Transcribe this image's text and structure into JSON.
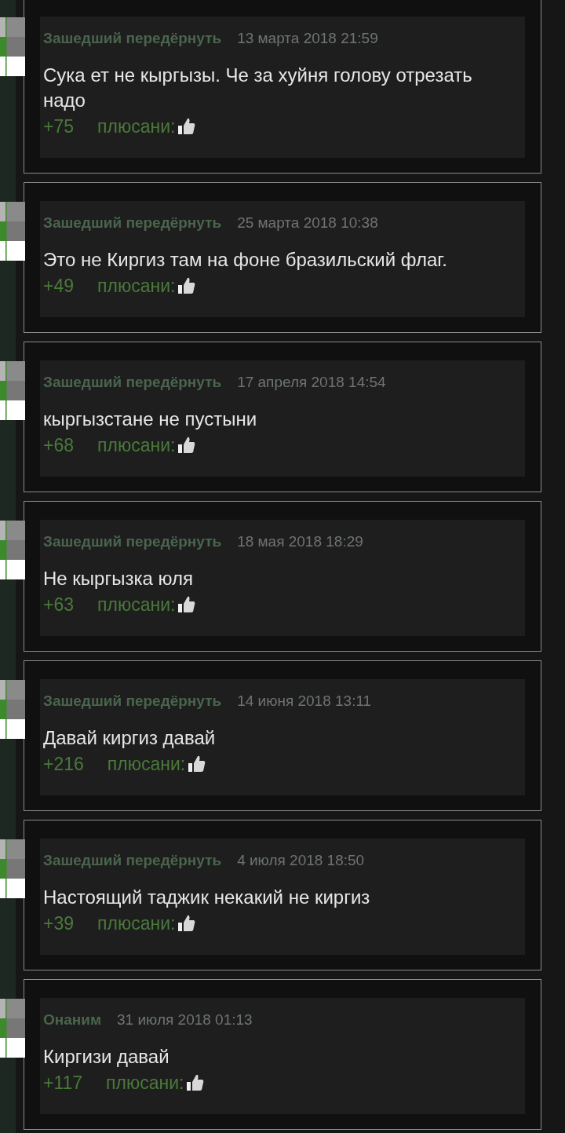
{
  "comments": [
    {
      "author": "Зашедший передёрнуть",
      "date": "13 марта 2018 21:59",
      "text": "Сука ет не кыргызы. Че за хуйня голову отрезать надо",
      "rating": "+75",
      "rate_label": "плюсани:"
    },
    {
      "author": "Зашедший передёрнуть",
      "date": "25 марта 2018 10:38",
      "text": "Это не Киргиз там на фоне бразильский флаг.",
      "rating": "+49",
      "rate_label": "плюсани:"
    },
    {
      "author": "Зашедший передёрнуть",
      "date": "17 апреля 2018 14:54",
      "text": "кыргызстане не пустыни",
      "rating": "+68",
      "rate_label": "плюсани:"
    },
    {
      "author": "Зашедший передёрнуть",
      "date": "18 мая 2018 18:29",
      "text": "Не кыргызка юля",
      "rating": "+63",
      "rate_label": "плюсани:"
    },
    {
      "author": "Зашедший передёрнуть",
      "date": "14 июня 2018 13:11",
      "text": "Давай киргиз давай",
      "rating": "+216",
      "rate_label": "плюсани:"
    },
    {
      "author": "Зашедший передёрнуть",
      "date": "4 июля 2018 18:50",
      "text": "Настоящий таджик некакий не киргиз",
      "rating": "+39",
      "rate_label": "плюсани:"
    },
    {
      "author": "Онаним",
      "date": "31 июля 2018 01:13",
      "text": "Киргизи давай",
      "rating": "+117",
      "rate_label": "плюсани:"
    }
  ]
}
